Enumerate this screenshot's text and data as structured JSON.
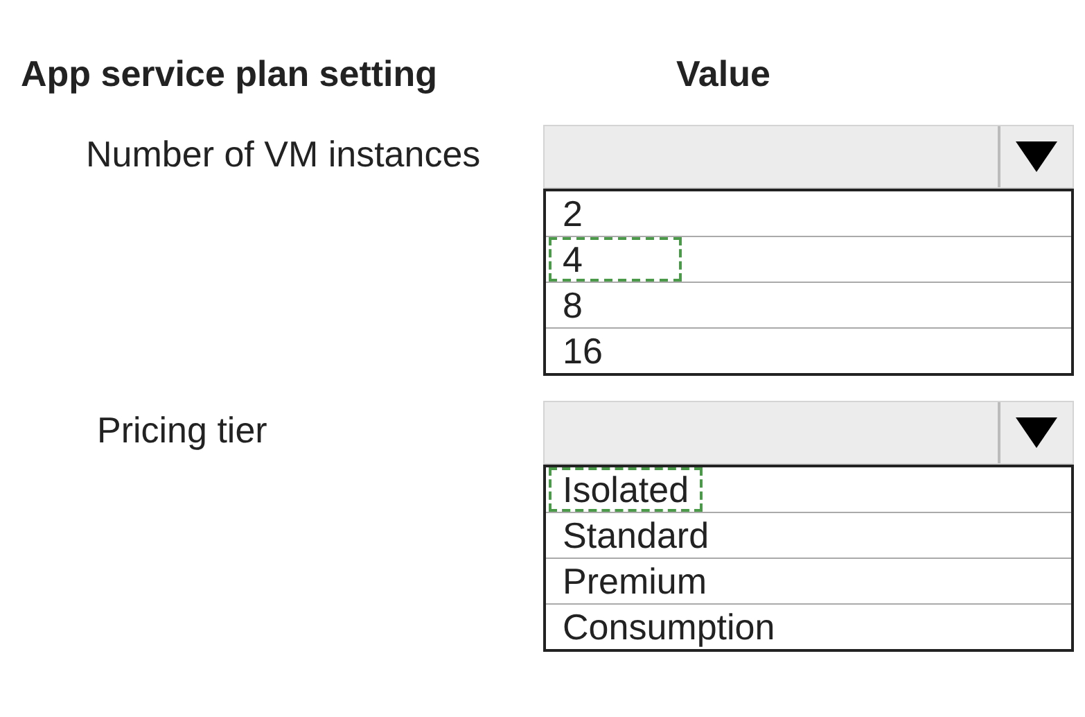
{
  "headers": {
    "setting": "App service plan setting",
    "value": "Value"
  },
  "settings": [
    {
      "label": "Number of VM instances",
      "options": [
        {
          "text": "2",
          "selected": false
        },
        {
          "text": "4",
          "selected": true
        },
        {
          "text": "8",
          "selected": false
        },
        {
          "text": "16",
          "selected": false
        }
      ]
    },
    {
      "label": "Pricing tier",
      "options": [
        {
          "text": "Isolated",
          "selected": true
        },
        {
          "text": "Standard",
          "selected": false
        },
        {
          "text": "Premium",
          "selected": false
        },
        {
          "text": "Consumption",
          "selected": false
        }
      ]
    }
  ]
}
